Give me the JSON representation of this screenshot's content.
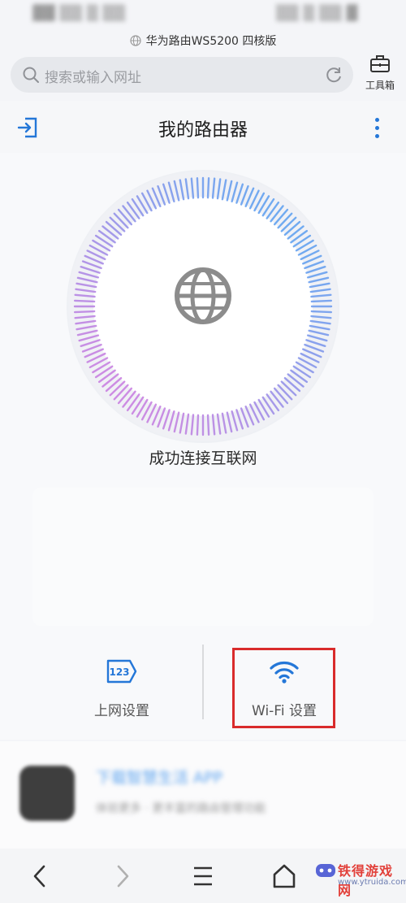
{
  "status_bar": {
    "left": "▓▓ ▒▒ ▒ ▒▒",
    "right": "▒▒ ▒ ▒▒ ▓"
  },
  "browser": {
    "site_title": "华为路由WS5200 四核版",
    "search_placeholder": "搜索或输入网址",
    "toolbox_label": "工具箱"
  },
  "app": {
    "title": "我的路由器",
    "status_text": "成功连接互联网",
    "actions": [
      {
        "label": "上网设置",
        "icon": "123-tag-icon"
      },
      {
        "label": "Wi-Fi 设置",
        "icon": "wifi-icon"
      }
    ]
  },
  "ad": {
    "title": "下载智慧生活 APP",
    "subtitle": "体验更多 · 更丰富的路由管理功能"
  },
  "nav": [
    "back-icon",
    "forward-icon",
    "menu-icon",
    "home-icon"
  ],
  "watermark": {
    "name": "铁得游戏网",
    "url": "www.ytruida.com"
  },
  "colors": {
    "accent": "#2477d8",
    "highlight": "#d92b2b",
    "ring_start": "#c77be0",
    "ring_end": "#5a9ef0"
  }
}
